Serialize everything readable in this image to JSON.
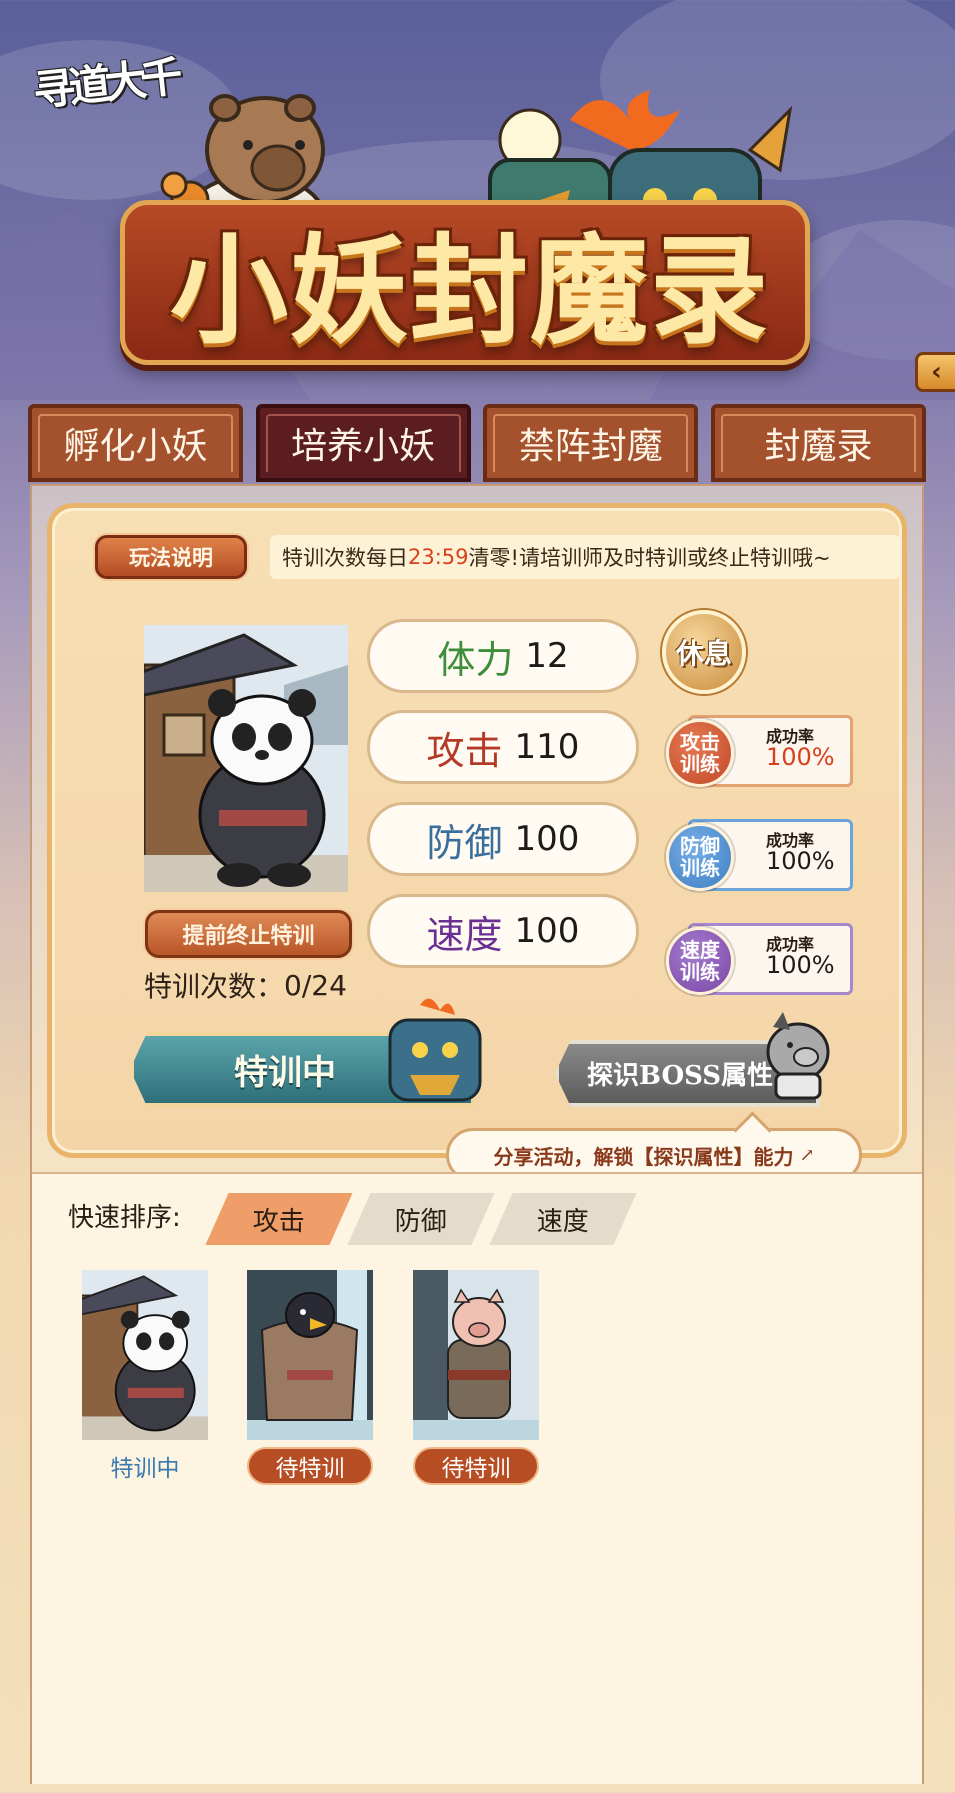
{
  "header": {
    "logo_text": "寻道大千",
    "title": "小妖封魔录"
  },
  "tabs": [
    {
      "label": "孵化小妖",
      "active": false
    },
    {
      "label": "培养小妖",
      "active": true
    },
    {
      "label": "禁阵封魔",
      "active": false
    },
    {
      "label": "封魔录",
      "active": false
    }
  ],
  "training": {
    "rules_label": "玩法说明",
    "notice_prefix": "特训次数每日",
    "notice_time": "23:59",
    "notice_suffix": "清零!请培训师及时特训或终止特训哦~",
    "stats": [
      {
        "label": "体力",
        "value": "12",
        "color": "#3c8e3a"
      },
      {
        "label": "攻击",
        "value": "110",
        "color": "#b33a28"
      },
      {
        "label": "防御",
        "value": "100",
        "color": "#3a6e9c"
      },
      {
        "label": "速度",
        "value": "100",
        "color": "#6b2f94"
      }
    ],
    "rest_label": "休息",
    "skills": [
      {
        "name_line1": "攻击",
        "name_line2": "训练",
        "rate_label": "成功率",
        "rate": "100%",
        "orb_color": "#c2482a",
        "border_color": "#e4a26e",
        "rate_color": "#d6401c"
      },
      {
        "name_line1": "防御",
        "name_line2": "训练",
        "rate_label": "成功率",
        "rate": "100%",
        "orb_color": "#3d7fc4",
        "border_color": "#6aa4d8",
        "rate_color": "#1e1a18"
      },
      {
        "name_line1": "速度",
        "name_line2": "训练",
        "rate_label": "成功率",
        "rate": "100%",
        "orb_color": "#7b47a8",
        "border_color": "#a886cc",
        "rate_color": "#1e1a18"
      }
    ],
    "stop_label": "提前终止特训",
    "count_label": "特训次数：",
    "count_value": "0/24",
    "training_button": "特训中",
    "detect_button": "探识BOSS属性",
    "share_text": "分享活动，解锁【探识属性】能力"
  },
  "sort": {
    "label": "快速排序:",
    "options": [
      {
        "label": "攻击",
        "active": true
      },
      {
        "label": "防御",
        "active": false
      },
      {
        "label": "速度",
        "active": false
      }
    ]
  },
  "monsters": [
    {
      "kind": "panda",
      "status": "特训中",
      "status_type": "status"
    },
    {
      "kind": "eagle",
      "status": "待特训",
      "status_type": "btn"
    },
    {
      "kind": "pig",
      "status": "待特训",
      "status_type": "btn"
    }
  ],
  "colors": {
    "active_tab": "#5c1d20",
    "tab": "#a4512e",
    "accent": "#ef9e6a"
  }
}
